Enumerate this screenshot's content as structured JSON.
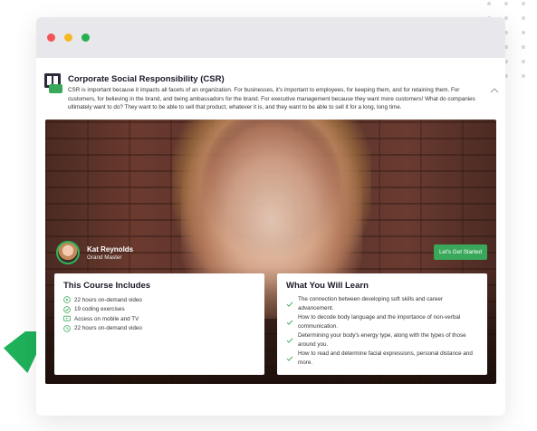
{
  "course": {
    "title": "Corporate Social Responsibility (CSR)",
    "description": "CSR is important because it impacts all facets of an organization. For businesses, it's important to employees, for keeping them, and for retaining them. For customers, for believing in the brand, and being ambassadors for the brand. For executive management because they want more customers! What do companies ultimately want to do? They want to be able to sell that product, whatever it is, and they want to be able to sell it for a long, long time."
  },
  "instructor": {
    "name": "Kat Reynolds",
    "role": "Grand Master"
  },
  "cta": {
    "label": "Let's Get Started"
  },
  "includes": {
    "heading": "This Course Includes",
    "items": [
      {
        "icon": "play-circle-icon",
        "label": "22 hours on-demand video"
      },
      {
        "icon": "check-circle-icon",
        "label": "19 coding exercises"
      },
      {
        "icon": "tv-icon",
        "label": "Access on mobile and TV"
      },
      {
        "icon": "clock-icon",
        "label": "22 hours on-demand video"
      }
    ]
  },
  "learn": {
    "heading": "What You Will Learn",
    "items": [
      "The connection between developing soft skills and career advancement.",
      "How to decode body language and the importance of non-verbal communication.",
      "Determining your body's energy type, along with the types of those around you.",
      "How to read and determine facial expressions, personal distance and more."
    ]
  },
  "colors": {
    "accent_green": "#3aa85b",
    "triangle_green": "#1fb25a",
    "titlebar": "#e8e8ec",
    "traffic_red": "#f25353",
    "traffic_yellow": "#f5b921",
    "traffic_green": "#25b050"
  }
}
